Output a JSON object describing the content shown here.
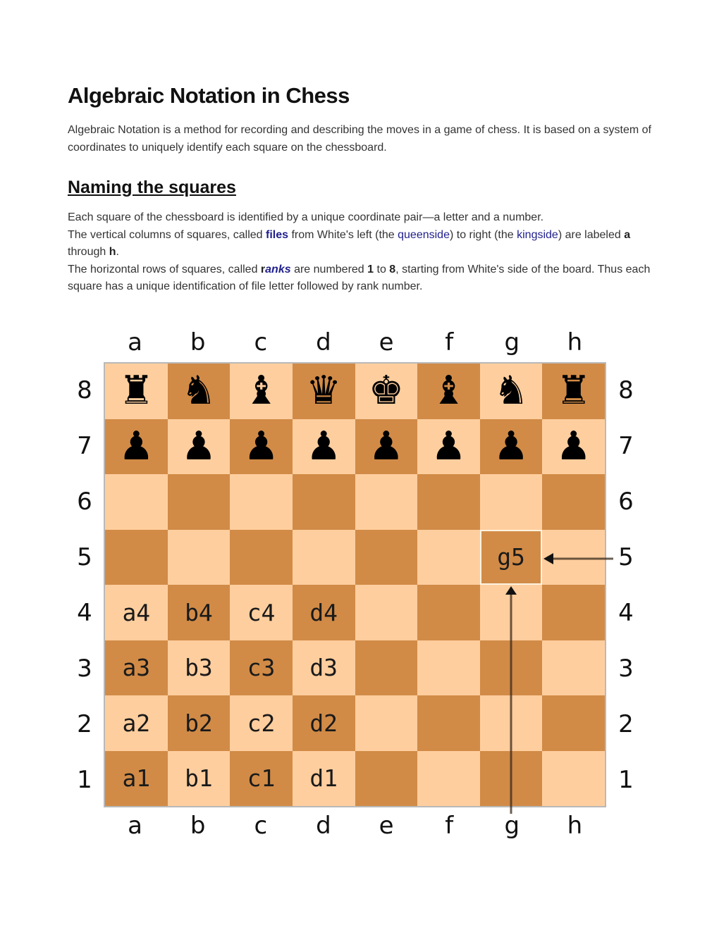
{
  "title": "Algebraic Notation in Chess",
  "intro": "Algebraic Notation is a method for recording and describing the moves in a game of chess. It is based on a system of coordinates to uniquely identify each square on the chessboard.",
  "section": {
    "heading": "Naming the squares",
    "p1": "Each square of the chessboard is identified by a unique coordinate pair—a letter and a number.",
    "p2": {
      "t1": "The vertical columns of squares, called ",
      "files": "files",
      "t2": " from White's left (the ",
      "queenside": "queenside",
      "t3": ") to right (the ",
      "kingside": "kingside",
      "t4": ") are labeled ",
      "a": "a",
      "t5": " through ",
      "h": "h",
      "t6": "."
    },
    "p3": {
      "t1": "The horizontal rows of squares, called ",
      "ranks_r": "r",
      "ranks_rest": "anks",
      "t2": " are numbered ",
      "one": "1",
      "t3": " to ",
      "eight": "8",
      "t4": ", starting from White's side of the board. Thus each square has a unique identification of file letter followed by rank number."
    }
  },
  "diagram": {
    "files": [
      "a",
      "b",
      "c",
      "d",
      "e",
      "f",
      "g",
      "h"
    ],
    "ranks": [
      "8",
      "7",
      "6",
      "5",
      "4",
      "3",
      "2",
      "1"
    ],
    "colors": {
      "light": "#ffce9e",
      "dark": "#d18b47",
      "arrow": "#3a2a1a"
    },
    "pieces": {
      "a8": "♜",
      "b8": "♞",
      "c8": "♝",
      "d8": "♛",
      "e8": "♚",
      "f8": "♝",
      "g8": "♞",
      "h8": "♜",
      "a7": "♟",
      "b7": "♟",
      "c7": "♟",
      "d7": "♟",
      "e7": "♟",
      "f7": "♟",
      "g7": "♟",
      "h7": "♟"
    },
    "piece_names": {
      "♜": "black-rook-icon",
      "♞": "black-knight-icon",
      "♝": "black-bishop-icon",
      "♛": "black-queen-icon",
      "♚": "black-king-icon",
      "♟": "black-pawn-icon"
    },
    "square_labels": {
      "a4": "a4",
      "b4": "b4",
      "c4": "c4",
      "d4": "d4",
      "a3": "a3",
      "b3": "b3",
      "c3": "c3",
      "d3": "d3",
      "a2": "a2",
      "b2": "b2",
      "c2": "c2",
      "d2": "d2",
      "a1": "a1",
      "b1": "b1",
      "c1": "c1",
      "d1": "d1",
      "g5": "g5"
    },
    "highlighted_square": "g5"
  }
}
